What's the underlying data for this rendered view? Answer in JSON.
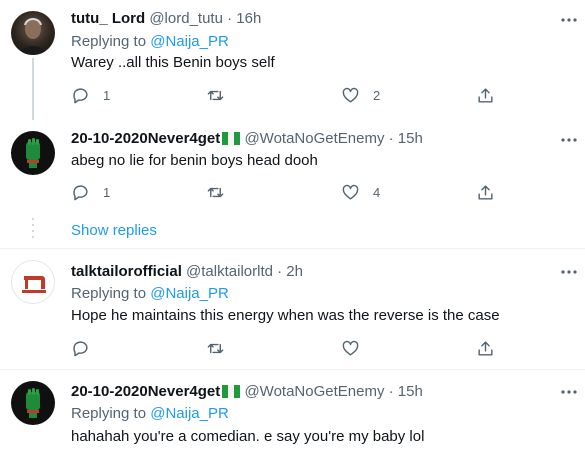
{
  "tweets": [
    {
      "name": "tutu_ Lord",
      "handle": "@lord_tutu",
      "time": "· 16h",
      "replying_prefix": "Replying to",
      "replying_handle": "@Naija_PR",
      "text": "Warey ..all this Benin boys self",
      "reply_count": "1",
      "retweet_count": "",
      "like_count": "2",
      "avatar_icon": "portrait-photo"
    },
    {
      "name": "20-10-2020Never4get",
      "handle": "@WotaNoGetEnemy",
      "time": "· 15h",
      "text": "abeg no lie for benin boys head dooh",
      "reply_count": "1",
      "retweet_count": "",
      "like_count": "4",
      "avatar_icon": "raised-fist-logo"
    },
    {
      "name": "talktailorofficial",
      "handle": "@talktailorltd",
      "time": "· 2h",
      "replying_prefix": "Replying to",
      "replying_handle": "@Naija_PR",
      "text": "Hope he maintains this energy when was the reverse is the case",
      "reply_count": "",
      "retweet_count": "",
      "like_count": "",
      "avatar_icon": "sewing-machine-logo"
    },
    {
      "name": "20-10-2020Never4get",
      "handle": "@WotaNoGetEnemy",
      "time": "· 15h",
      "replying_prefix": "Replying to",
      "replying_handle": "@Naija_PR",
      "text": "hahahah you're a comedian. e say you're my baby lol",
      "avatar_icon": "raised-fist-logo"
    }
  ],
  "show_replies_label": "Show replies",
  "colors": {
    "link": "#1d9bf0",
    "secondary_text": "#536471",
    "primary_text": "#0f1419",
    "thread_line": "#cfd9de",
    "divider": "#eff3f4"
  }
}
